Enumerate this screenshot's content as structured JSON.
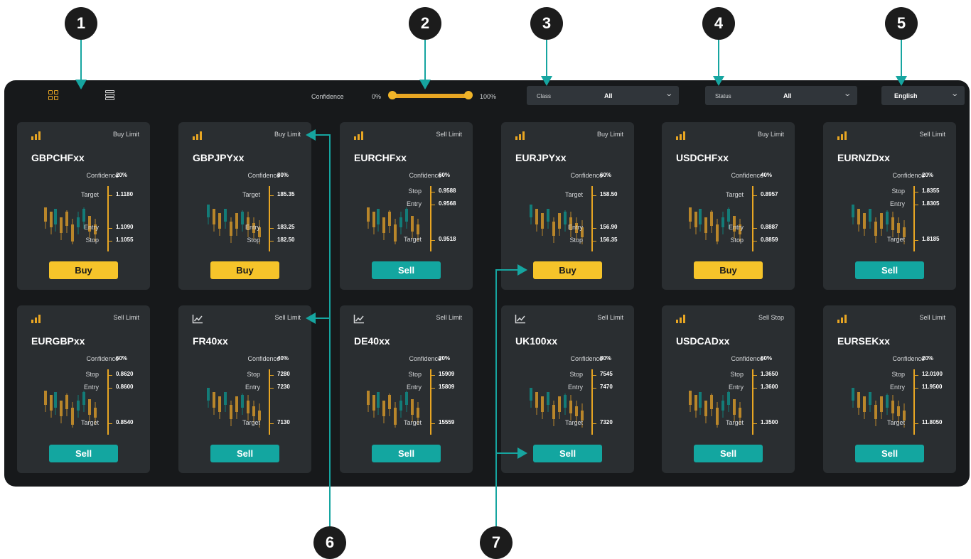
{
  "callouts": [
    "1",
    "2",
    "3",
    "4",
    "5",
    "6",
    "7"
  ],
  "toolbar": {
    "confidence_label": "Confidence",
    "confidence_min": "0%",
    "confidence_max": "100%",
    "confidence_range": [
      0,
      100
    ],
    "class_label": "Class",
    "class_value": "All",
    "status_label": "Status",
    "status_value": "All",
    "language_value": "English",
    "active_view": "grid"
  },
  "colors": {
    "panel": "#17191b",
    "card": "#2a2e31",
    "accent_gold": "#e8a623",
    "buy": "#f6c42a",
    "sell": "#13a6a0",
    "callout": "#1c1c1c",
    "leader": "#16a5a0"
  },
  "cards": [
    {
      "icon": "signal-bars-icon",
      "order": "Buy Limit",
      "symbol": "GBPCHFxx",
      "conf_label": "Confidence",
      "conf": "20%",
      "side": "Buy",
      "levels": [
        {
          "label": "Target",
          "value": "1.1180"
        },
        {
          "label": "Entry",
          "value": "1.1090"
        },
        {
          "label": "Stop",
          "value": "1.1055"
        }
      ]
    },
    {
      "icon": "signal-bars-icon",
      "order": "Buy Limit",
      "symbol": "GBPJPYxx",
      "conf_label": "Confidence",
      "conf": "80%",
      "side": "Buy",
      "levels": [
        {
          "label": "Target",
          "value": "185.35"
        },
        {
          "label": "Entry",
          "value": "183.25"
        },
        {
          "label": "Stop",
          "value": "182.50"
        }
      ]
    },
    {
      "icon": "signal-bars-icon",
      "order": "Sell Limit",
      "symbol": "EURCHFxx",
      "conf_label": "Confidence",
      "conf": "60%",
      "side": "Sell",
      "levels": [
        {
          "label": "Stop",
          "value": "0.9588"
        },
        {
          "label": "Entry",
          "value": "0.9568"
        },
        {
          "label": "Target",
          "value": "0.9518"
        }
      ]
    },
    {
      "icon": "signal-bars-icon",
      "order": "Buy Limit",
      "symbol": "EURJPYxx",
      "conf_label": "Confidence",
      "conf": "60%",
      "side": "Buy",
      "levels": [
        {
          "label": "Target",
          "value": "158.50"
        },
        {
          "label": "Entry",
          "value": "156.90"
        },
        {
          "label": "Stop",
          "value": "156.35"
        }
      ]
    },
    {
      "icon": "signal-bars-icon",
      "order": "Buy Limit",
      "symbol": "USDCHFxx",
      "conf_label": "Confidence",
      "conf": "40%",
      "side": "Buy",
      "levels": [
        {
          "label": "Target",
          "value": "0.8957"
        },
        {
          "label": "Entry",
          "value": "0.8887"
        },
        {
          "label": "Stop",
          "value": "0.8859"
        }
      ]
    },
    {
      "icon": "signal-bars-icon",
      "order": "Sell Limit",
      "symbol": "EURNZDxx",
      "conf_label": "Confidence",
      "conf": "20%",
      "side": "Sell",
      "levels": [
        {
          "label": "Stop",
          "value": "1.8355"
        },
        {
          "label": "Entry",
          "value": "1.8305"
        },
        {
          "label": "Target",
          "value": "1.8185"
        }
      ]
    },
    {
      "icon": "signal-bars-icon",
      "order": "Sell Limit",
      "symbol": "EURGBPxx",
      "conf_label": "Confidence",
      "conf": "60%",
      "side": "Sell",
      "levels": [
        {
          "label": "Stop",
          "value": "0.8620"
        },
        {
          "label": "Entry",
          "value": "0.8600"
        },
        {
          "label": "Target",
          "value": "0.8540"
        }
      ]
    },
    {
      "icon": "line-chart-icon",
      "order": "Sell Limit",
      "symbol": "FR40xx",
      "conf_label": "Confidence",
      "conf": "40%",
      "side": "Sell",
      "levels": [
        {
          "label": "Stop",
          "value": "7280"
        },
        {
          "label": "Entry",
          "value": "7230"
        },
        {
          "label": "Target",
          "value": "7130"
        }
      ]
    },
    {
      "icon": "line-chart-icon",
      "order": "Sell Limit",
      "symbol": "DE40xx",
      "conf_label": "Confidence",
      "conf": "20%",
      "side": "Sell",
      "levels": [
        {
          "label": "Stop",
          "value": "15909"
        },
        {
          "label": "Entry",
          "value": "15809"
        },
        {
          "label": "Target",
          "value": "15559"
        }
      ]
    },
    {
      "icon": "line-chart-icon",
      "order": "Sell Limit",
      "symbol": "UK100xx",
      "conf_label": "Confidence",
      "conf": "80%",
      "side": "Sell",
      "levels": [
        {
          "label": "Stop",
          "value": "7545"
        },
        {
          "label": "Entry",
          "value": "7470"
        },
        {
          "label": "Target",
          "value": "7320"
        }
      ]
    },
    {
      "icon": "signal-bars-icon",
      "order": "Sell Stop",
      "symbol": "USDCADxx",
      "conf_label": "Confidence",
      "conf": "60%",
      "side": "Sell",
      "levels": [
        {
          "label": "Stop",
          "value": "1.3650"
        },
        {
          "label": "Entry",
          "value": "1.3600"
        },
        {
          "label": "Target",
          "value": "1.3500"
        }
      ]
    },
    {
      "icon": "signal-bars-icon",
      "order": "Sell Limit",
      "symbol": "EURSEKxx",
      "conf_label": "Confidence",
      "conf": "20%",
      "side": "Sell",
      "levels": [
        {
          "label": "Stop",
          "value": "12.0100"
        },
        {
          "label": "Entry",
          "value": "11.9500"
        },
        {
          "label": "Target",
          "value": "11.8050"
        }
      ]
    }
  ]
}
